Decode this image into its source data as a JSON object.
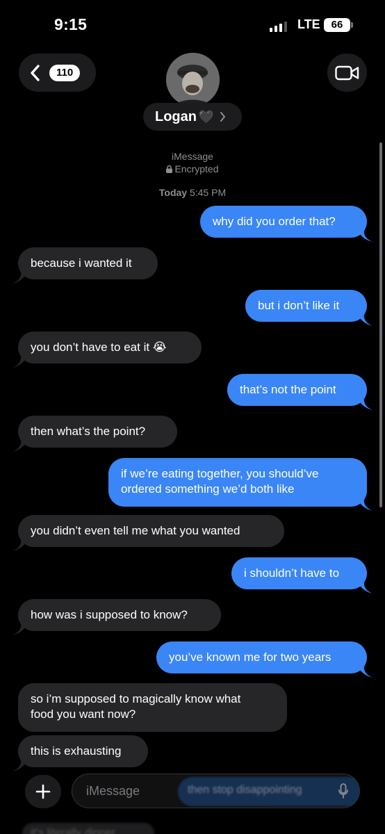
{
  "status_bar": {
    "time": "9:15",
    "carrier": "LTE",
    "battery": "66"
  },
  "header": {
    "unread_count": "110",
    "contact_name": "Logan",
    "contact_heart": "🖤",
    "service": "iMessage",
    "encryption": "Encrypted",
    "timestamp_day": "Today",
    "timestamp_time": "5:45 PM"
  },
  "messages": [
    {
      "from": "me",
      "text": "why did you order that?"
    },
    {
      "from": "them",
      "text": "because i wanted it"
    },
    {
      "from": "me",
      "text": "but i don’t like it"
    },
    {
      "from": "them",
      "text": "you don’t have to eat it 😭"
    },
    {
      "from": "me",
      "text": "that’s not the point"
    },
    {
      "from": "them",
      "text": "then what’s the point?"
    },
    {
      "from": "me",
      "line1": "if we’re eating together, you should’ve",
      "line2": "ordered something we’d both like"
    },
    {
      "from": "them",
      "text": "you didn’t even tell me what you wanted"
    },
    {
      "from": "me",
      "text": "i shouldn’t have to"
    },
    {
      "from": "them",
      "text": "how was i supposed to know?"
    },
    {
      "from": "me",
      "text": "you’ve known me for two years"
    },
    {
      "from": "them",
      "line1": "so i’m supposed to magically know what",
      "line2": "food you want now?"
    },
    {
      "from": "them",
      "text": "this is exhausting"
    }
  ],
  "input": {
    "placeholder": "iMessage",
    "behind_sent_text": "then stop disappointing",
    "behind_received_text": "it's literally dinner"
  },
  "colors": {
    "sent_bubble": "#3a86f6",
    "received_bubble": "#262628",
    "background": "#000000"
  },
  "icons": [
    "back-chevron-icon",
    "video-camera-icon",
    "plus-icon",
    "microphone-icon",
    "lock-icon",
    "chevron-right-icon"
  ]
}
